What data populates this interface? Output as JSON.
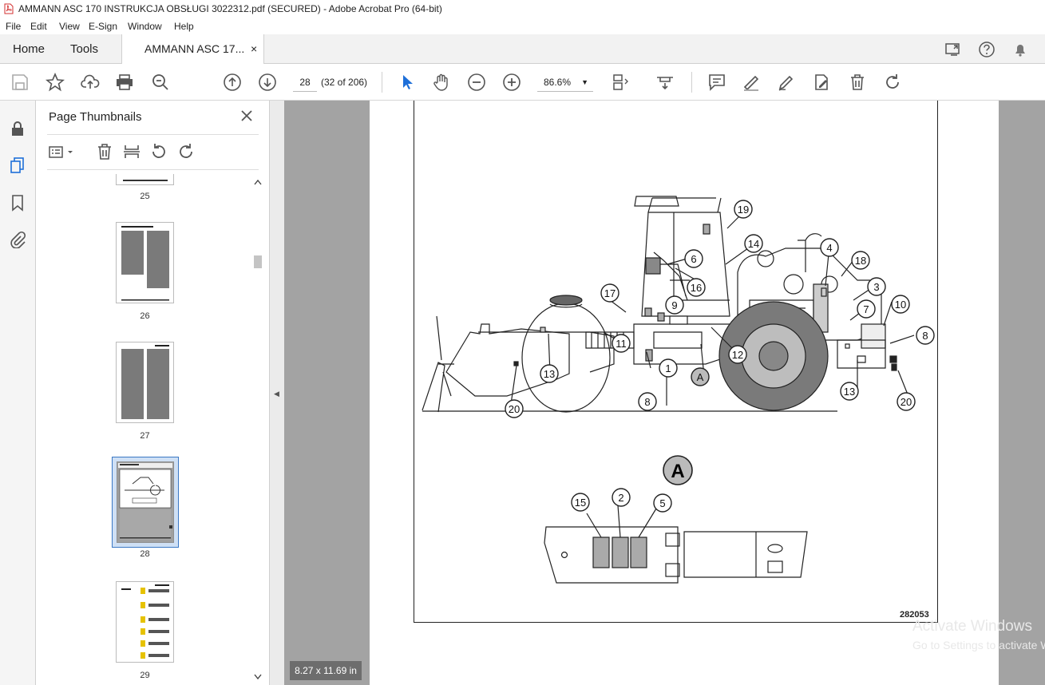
{
  "window": {
    "title": "AMMANN ASC 170 INSTRUKCJA OBSŁUGI 3022312.pdf (SECURED) - Adobe Acrobat Pro (64-bit)"
  },
  "menu": [
    "File",
    "Edit",
    "View",
    "E-Sign",
    "Window",
    "Help"
  ],
  "tabs": {
    "home": "Home",
    "tools": "Tools",
    "doc": "AMMANN ASC 17...",
    "close": "×"
  },
  "toolbar": {
    "page_number": "28",
    "page_count": "(32 of 206)",
    "zoom": "86.6%"
  },
  "thumbnails": {
    "title": "Page Thumbnails",
    "pages": [
      "25",
      "26",
      "27",
      "28",
      "29"
    ],
    "selected": "28"
  },
  "document": {
    "page_size": "8.27 x 11.69 in",
    "figure_id": "282053",
    "callouts_main": [
      "19",
      "14",
      "6",
      "16",
      "4",
      "18",
      "3",
      "17",
      "9",
      "7",
      "10",
      "8",
      "11",
      "12",
      "1",
      "A",
      "13",
      "8",
      "20",
      "13",
      "20"
    ],
    "detail_label": "A",
    "callouts_detail": [
      "15",
      "2",
      "5"
    ]
  },
  "watermark": {
    "line1": "Activate Windows",
    "line2": "Go to Settings to activate Windows."
  }
}
